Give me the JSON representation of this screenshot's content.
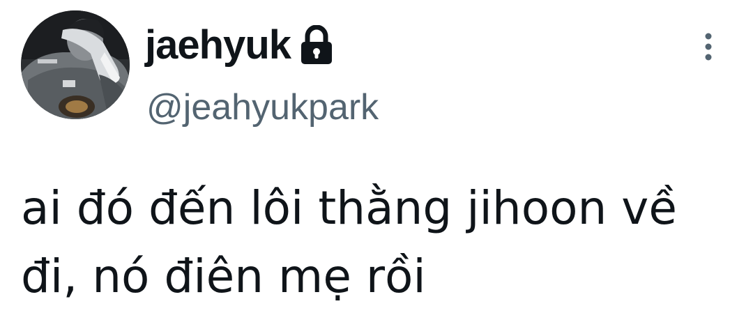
{
  "tweet": {
    "author": {
      "display_name": "jaehyuk",
      "handle": "@jeahyukpark",
      "protected_icon": "lock-icon",
      "avatar": "profile-photo"
    },
    "more_icon": "vertical-ellipsis-icon",
    "text": "ai đó đến lôi thằng jihoon về\nđi, nó điên mẹ rồi"
  }
}
